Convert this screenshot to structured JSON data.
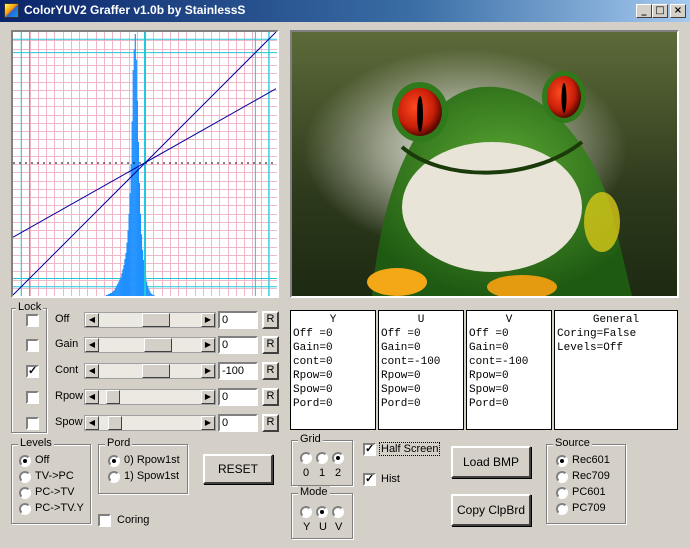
{
  "window": {
    "title": "ColorYUV2 Graffer v1.0b by StainlessS"
  },
  "controls": [
    {
      "label": "Off",
      "locked": false,
      "value": "0",
      "reset": "R",
      "thumb": 0.48
    },
    {
      "label": "Gain",
      "locked": false,
      "value": "0",
      "reset": "R",
      "thumb": 0.5
    },
    {
      "label": "Cont",
      "locked": true,
      "value": "-100",
      "reset": "R",
      "thumb": 0.48
    },
    {
      "label": "Rpow",
      "locked": false,
      "value": "0",
      "reset": "R",
      "thumb": 0.08
    },
    {
      "label": "Spow",
      "locked": false,
      "value": "0",
      "reset": "R",
      "thumb": 0.1
    }
  ],
  "lock_group": {
    "title": "Lock"
  },
  "panels": [
    {
      "title": "Y",
      "lines": [
        "Off =0",
        "Gain=0",
        "cont=0",
        "Rpow=0",
        "Spow=0",
        "Pord=0"
      ]
    },
    {
      "title": "U",
      "lines": [
        "Off =0",
        "Gain=0",
        "cont=-100",
        "Rpow=0",
        "Spow=0",
        "Pord=0"
      ]
    },
    {
      "title": "V",
      "lines": [
        "Off =0",
        "Gain=0",
        "cont=-100",
        "Rpow=0",
        "Spow=0",
        "Pord=0"
      ]
    },
    {
      "title": "General",
      "lines": [
        "Coring=False",
        "Levels=Off"
      ]
    }
  ],
  "levels": {
    "title": "Levels",
    "options": [
      "Off",
      "TV->PC",
      "PC->TV",
      "PC->TV.Y"
    ],
    "selected": 0
  },
  "pord": {
    "title": "Pord",
    "options": [
      "0) Rpow1st",
      "1) Spow1st"
    ],
    "selected": 0
  },
  "reset_button": "RESET",
  "coring": {
    "label": "Coring",
    "checked": false
  },
  "grid": {
    "title": "Grid",
    "options": [
      "0",
      "1",
      "2"
    ],
    "selected": 2
  },
  "mode": {
    "title": "Mode",
    "options": [
      "Y",
      "U",
      "V"
    ],
    "selected": 1
  },
  "half_screen": {
    "label": "Half Screen",
    "checked": true
  },
  "hist": {
    "label": "Hist",
    "checked": true
  },
  "load_bmp": "Load BMP",
  "copy_clipboard": "Copy ClpBrd",
  "source": {
    "title": "Source",
    "options": [
      "Rec601",
      "Rec709",
      "PC601",
      "PC709"
    ],
    "selected": 0
  },
  "colors": {
    "grid_minor": "#f0b8c8",
    "grid_major": "#22c8d8",
    "histogram": "#1e90ff",
    "curve": "#0000a0"
  },
  "chart_data": {
    "type": "area",
    "xlim": [
      0,
      255
    ],
    "ylim": [
      0,
      255
    ],
    "histogram": [
      0,
      0,
      0,
      0,
      0,
      0,
      0,
      0,
      0,
      0,
      0,
      0,
      0,
      0,
      0,
      0,
      0,
      0,
      0,
      0,
      0,
      0,
      0,
      0,
      0,
      0,
      0,
      0,
      0,
      0,
      0,
      0,
      0,
      0,
      0,
      0,
      0,
      0,
      0,
      0,
      0,
      0,
      0,
      0,
      0,
      0,
      0,
      0,
      0,
      0,
      0,
      0,
      0,
      0,
      0,
      0,
      0,
      0,
      0,
      0,
      0,
      0,
      0,
      0,
      0,
      0,
      0,
      0,
      0,
      0,
      0,
      0,
      0,
      0,
      0,
      0,
      0,
      0,
      0,
      0,
      0,
      0,
      0,
      0,
      0,
      0,
      0,
      0,
      0,
      0,
      1,
      1,
      2,
      2,
      3,
      3,
      4,
      5,
      6,
      8,
      10,
      12,
      14,
      16,
      18,
      22,
      26,
      30,
      36,
      42,
      52,
      64,
      80,
      100,
      128,
      170,
      220,
      240,
      255,
      230,
      190,
      150,
      110,
      80,
      60,
      45,
      35,
      28,
      20,
      14,
      10,
      7,
      5,
      3,
      2,
      1,
      1,
      0,
      0,
      0,
      0,
      0,
      0,
      0,
      0,
      0,
      0,
      0,
      0,
      0,
      0,
      0,
      0,
      0,
      0,
      0,
      0,
      0,
      0,
      0,
      0,
      0,
      0,
      0,
      0,
      0,
      0,
      0,
      0,
      0,
      0,
      0,
      0,
      0,
      0,
      0,
      0,
      0,
      0,
      0,
      0,
      0,
      0,
      0,
      0,
      0,
      0,
      0,
      0,
      0,
      0,
      0,
      0,
      0,
      0,
      0,
      0,
      0,
      0,
      0,
      0,
      0,
      0,
      0,
      0,
      0,
      0,
      0,
      0,
      0,
      0,
      0,
      0,
      0,
      0,
      0,
      0,
      0,
      0,
      0,
      0,
      0,
      0,
      0,
      0,
      0,
      0,
      0,
      0,
      0,
      0,
      0,
      0,
      0,
      0,
      0,
      0,
      0,
      0,
      0,
      0,
      0,
      0,
      0,
      0,
      0,
      0,
      0,
      0,
      0,
      0,
      0,
      0,
      0,
      0,
      0,
      0,
      0,
      0,
      0,
      0,
      0,
      0,
      0,
      0,
      0,
      0
    ],
    "series": [
      {
        "points": [
          [
            0,
            0
          ],
          [
            255,
            255
          ]
        ]
      },
      {
        "points": [
          [
            0,
            56
          ],
          [
            255,
            200
          ]
        ]
      }
    ]
  }
}
